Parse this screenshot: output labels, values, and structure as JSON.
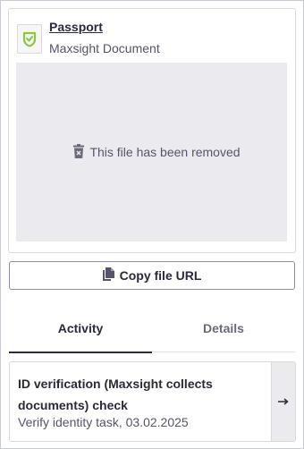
{
  "document": {
    "title": "Passport",
    "subtitle": "Maxsight Document",
    "icon": "shield-check-icon",
    "removed_message": "This file has been removed",
    "removed_icon": "trash-icon"
  },
  "copy_button": {
    "label": "Copy file URL",
    "icon": "copy-file-icon"
  },
  "tabs": [
    {
      "label": "Activity",
      "active": true
    },
    {
      "label": "Details",
      "active": false
    }
  ],
  "activity": {
    "title": "ID verification (Maxsight collects documents) check",
    "subtitle": "Verify identity task, 03.02.2025",
    "arrow_icon": "arrow-right-icon"
  },
  "colors": {
    "brand_green": "#8dc63f",
    "text": "#2b2b3d",
    "muted": "#55556a",
    "placeholder_bg": "#ebebef"
  }
}
